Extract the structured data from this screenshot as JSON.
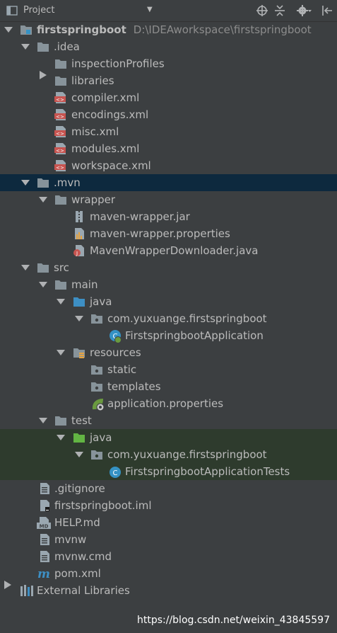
{
  "toolbar": {
    "title": "Project"
  },
  "tree": [
    {
      "label": "firstspringboot",
      "path": "D:\\IDEAworkspace\\firstspringboot"
    },
    {
      "label": ".idea"
    },
    {
      "label": "inspectionProfiles"
    },
    {
      "label": "libraries"
    },
    {
      "label": "compiler.xml"
    },
    {
      "label": "encodings.xml"
    },
    {
      "label": "misc.xml"
    },
    {
      "label": "modules.xml"
    },
    {
      "label": "workspace.xml"
    },
    {
      "label": ".mvn"
    },
    {
      "label": "wrapper"
    },
    {
      "label": "maven-wrapper.jar"
    },
    {
      "label": "maven-wrapper.properties"
    },
    {
      "label": "MavenWrapperDownloader.java"
    },
    {
      "label": "src"
    },
    {
      "label": "main"
    },
    {
      "label": "java"
    },
    {
      "label": "com.yuxuange.firstspringboot"
    },
    {
      "label": "FirstspringbootApplication"
    },
    {
      "label": "resources"
    },
    {
      "label": "static"
    },
    {
      "label": "templates"
    },
    {
      "label": "application.properties"
    },
    {
      "label": "test"
    },
    {
      "label": "java"
    },
    {
      "label": "com.yuxuange.firstspringboot"
    },
    {
      "label": "FirstspringbootApplicationTests"
    },
    {
      "label": ".gitignore"
    },
    {
      "label": "firstspringboot.iml"
    },
    {
      "label": "HELP.md"
    },
    {
      "label": "mvnw"
    },
    {
      "label": "mvnw.cmd"
    },
    {
      "label": "pom.xml"
    },
    {
      "label": "External Libraries"
    }
  ],
  "watermark": "https://blog.csdn.net/weixin_43845597",
  "colors": {
    "background": "#3c3f41",
    "selection_blue": "#0d293e",
    "selection_green": "#2e3b2d",
    "text": "#bbbbbb"
  }
}
